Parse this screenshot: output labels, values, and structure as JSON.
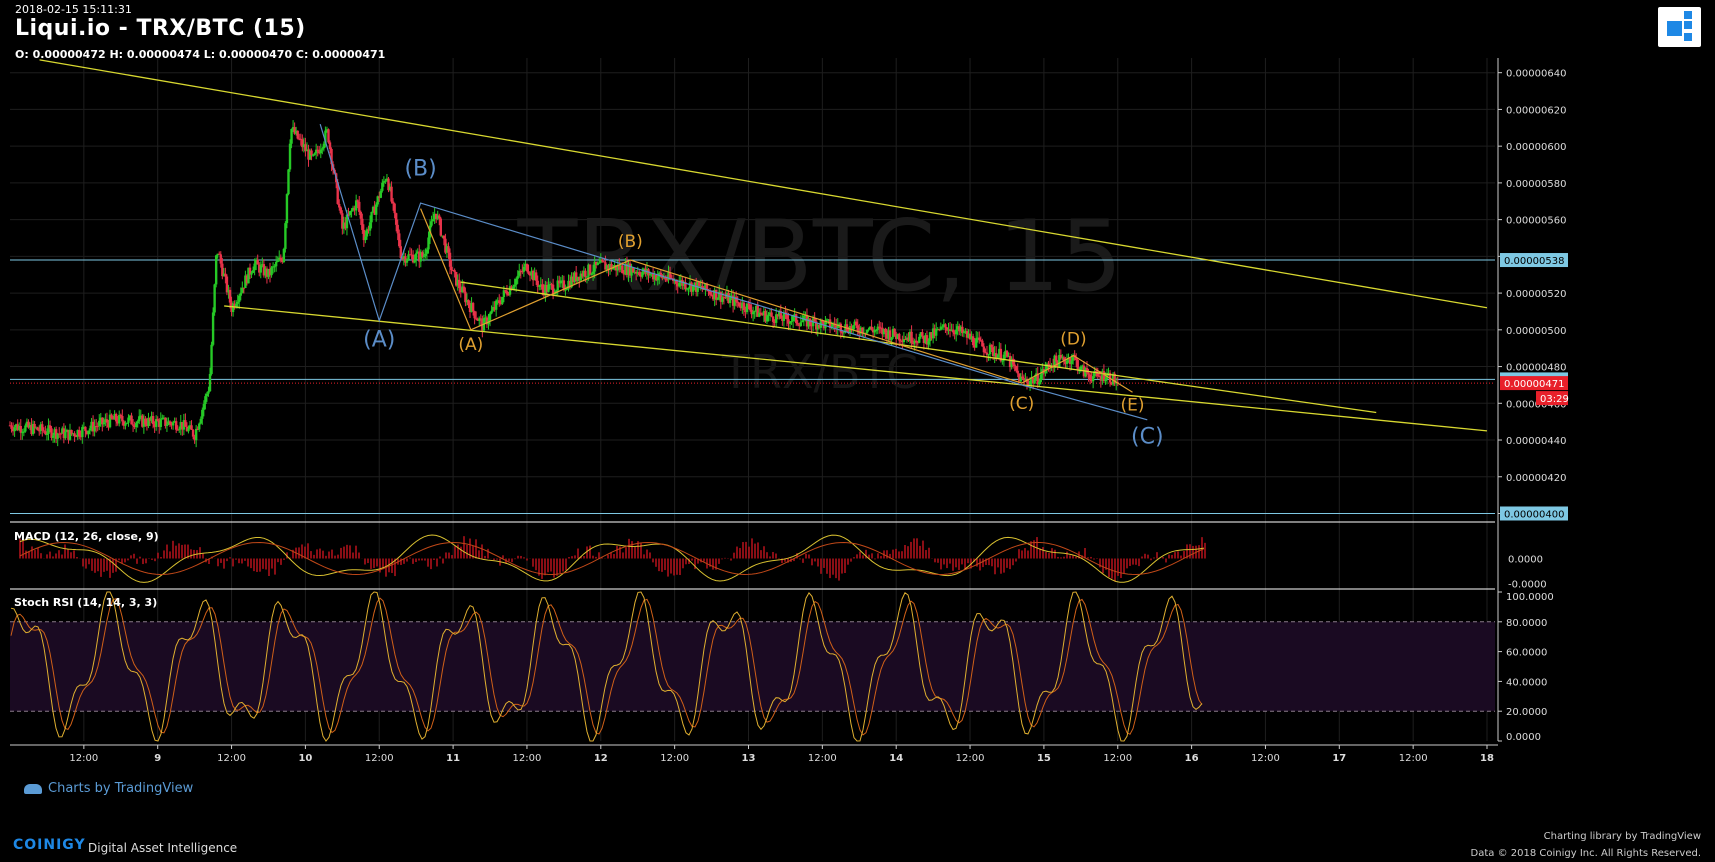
{
  "header": {
    "timestamp": "2018-02-15 15:11:31",
    "title": "Liqui.io - TRX/BTC (15)",
    "ohlc": "O: 0.00000472 H: 0.00000474 L: 0.00000470 C: 0.00000471"
  },
  "watermark": {
    "line1": "TRX/BTC, 15",
    "line2": "TRX/BTC"
  },
  "footer": {
    "brand": "COINIGY",
    "tagline": "Digital Asset Intelligence",
    "tv_link": "Charts by TradingView",
    "library_credit": "Charting library by  TradingView",
    "copyright": "Data © 2018  Coinigy Inc. All Rights Reserved."
  },
  "colors": {
    "background": "#000000",
    "up_candle": "#26c926",
    "down_candle": "#e8334a",
    "trendline": "#d8d830",
    "wave_blue": "#5b8dc8",
    "wave_orange": "#e0a030",
    "horizontal_level": "#7ec8e3",
    "price_tag": "#e8202a",
    "rsi_band": "#1a0a22"
  },
  "chart_data": [
    {
      "type": "candlestick",
      "title": "TRX/BTC, 15",
      "y_ticks": [
        "0.00000640",
        "0.00000620",
        "0.00000600",
        "0.00000580",
        "0.00000560",
        "0.00000540",
        "0.00000520",
        "0.00000500",
        "0.00000480",
        "0.00000460",
        "0.00000440",
        "0.00000420",
        "0.00000400"
      ],
      "ylim": [
        3.97e-06,
        6.48e-06
      ],
      "x_ticks": [
        "12:00",
        "9",
        "12:00",
        "10",
        "12:00",
        "11",
        "12:00",
        "12",
        "12:00",
        "13",
        "12:00",
        "14",
        "12:00",
        "15",
        "12:00",
        "16",
        "12:00",
        "17",
        "12:00",
        "18"
      ],
      "x_tick_days": [
        8.5,
        9,
        9.5,
        10,
        10.5,
        11,
        11.5,
        12,
        12.5,
        13,
        13.5,
        14,
        14.5,
        15,
        15.5,
        16,
        16.5,
        17,
        17.5,
        18
      ],
      "xlim": [
        8.0,
        18.0
      ],
      "price_path": [
        [
          8.0,
          4.48e-06
        ],
        [
          8.4,
          4.43e-06
        ],
        [
          8.7,
          4.51e-06
        ],
        [
          9.15,
          4.49e-06
        ],
        [
          9.25,
          4.43e-06
        ],
        [
          9.35,
          4.7e-06
        ],
        [
          9.4,
          5.45e-06
        ],
        [
          9.5,
          5.12e-06
        ],
        [
          9.65,
          5.36e-06
        ],
        [
          9.75,
          5.3e-06
        ],
        [
          9.85,
          5.4e-06
        ],
        [
          9.9,
          6.1e-06
        ],
        [
          10.05,
          5.92e-06
        ],
        [
          10.15,
          6.08e-06
        ],
        [
          10.25,
          5.55e-06
        ],
        [
          10.35,
          5.7e-06
        ],
        [
          10.4,
          5.5e-06
        ],
        [
          10.55,
          5.85e-06
        ],
        [
          10.65,
          5.4e-06
        ],
        [
          10.8,
          5.4e-06
        ],
        [
          10.88,
          5.65e-06
        ],
        [
          11.0,
          5.3e-06
        ],
        [
          11.1,
          5.15e-06
        ],
        [
          11.2,
          5.02e-06
        ],
        [
          11.35,
          5.2e-06
        ],
        [
          11.5,
          5.35e-06
        ],
        [
          11.6,
          5.22e-06
        ],
        [
          11.75,
          5.24e-06
        ],
        [
          11.85,
          5.3e-06
        ],
        [
          12.0,
          5.35e-06
        ],
        [
          12.2,
          5.33e-06
        ],
        [
          12.45,
          5.28e-06
        ],
        [
          12.7,
          5.22e-06
        ],
        [
          12.95,
          5.14e-06
        ],
        [
          13.1,
          5.08e-06
        ],
        [
          13.35,
          5.05e-06
        ],
        [
          13.6,
          5.02e-06
        ],
        [
          13.85,
          5e-06
        ],
        [
          14.0,
          4.97e-06
        ],
        [
          14.2,
          4.95e-06
        ],
        [
          14.35,
          5.02e-06
        ],
        [
          14.45,
          4.98e-06
        ],
        [
          14.6,
          4.9e-06
        ],
        [
          14.75,
          4.85e-06
        ],
        [
          14.85,
          4.72e-06
        ],
        [
          14.95,
          4.73e-06
        ],
        [
          15.05,
          4.82e-06
        ],
        [
          15.2,
          4.85e-06
        ],
        [
          15.25,
          4.78e-06
        ],
        [
          15.35,
          4.74e-06
        ],
        [
          15.42,
          4.76e-06
        ],
        [
          15.5,
          4.71e-06
        ]
      ],
      "last_price": "0.00000471",
      "countdown": "03:29",
      "levels": [
        {
          "value": 5.38e-06,
          "label": "0.00000538"
        },
        {
          "value": 4.73e-06,
          "label": "0.00000473"
        },
        {
          "value": 4e-06,
          "label": "0.00000400"
        }
      ],
      "trendlines": [
        {
          "from": [
            8.2,
            6.47e-06
          ],
          "to": [
            18.0,
            5.12e-06
          ]
        },
        {
          "from": [
            9.45,
            5.13e-06
          ],
          "to": [
            18.0,
            4.45e-06
          ]
        },
        {
          "from": [
            11.05,
            5.26e-06
          ],
          "to": [
            17.25,
            4.55e-06
          ]
        }
      ],
      "waves": [
        {
          "name": "blue",
          "color": "#5b8dc8",
          "points": [
            [
              10.1,
              6.12e-06
            ],
            [
              10.5,
              5.05e-06
            ],
            [
              10.78,
              5.69e-06
            ],
            [
              14.85,
              4.7e-06
            ],
            [
              15.7,
              4.51e-06
            ]
          ]
        },
        {
          "name": "orange",
          "color": "#e0a030",
          "points": [
            [
              10.78,
              5.66e-06
            ],
            [
              11.12,
              5e-06
            ],
            [
              12.2,
              5.38e-06
            ],
            [
              14.85,
              4.71e-06
            ],
            [
              15.2,
              4.86e-06
            ],
            [
              15.6,
              4.66e-06
            ]
          ]
        }
      ],
      "wave_labels": [
        {
          "text": "(B)",
          "x": 10.78,
          "y": 5.84e-06,
          "color": "#5b8dc8",
          "size": 22
        },
        {
          "text": "(A)",
          "x": 10.5,
          "y": 4.91e-06,
          "color": "#5b8dc8",
          "size": 22
        },
        {
          "text": "(C)",
          "x": 15.7,
          "y": 4.38e-06,
          "color": "#5b8dc8",
          "size": 22
        },
        {
          "text": "(B)",
          "x": 12.2,
          "y": 5.45e-06,
          "color": "#e0a030",
          "size": 17
        },
        {
          "text": "(A)",
          "x": 11.12,
          "y": 4.89e-06,
          "color": "#e0a030",
          "size": 17
        },
        {
          "text": "(D)",
          "x": 15.2,
          "y": 4.92e-06,
          "color": "#e0a030",
          "size": 17
        },
        {
          "text": "(C)",
          "x": 14.85,
          "y": 4.57e-06,
          "color": "#e0a030",
          "size": 17
        },
        {
          "text": "(E)",
          "x": 15.6,
          "y": 4.56e-06,
          "color": "#e0a030",
          "size": 17
        }
      ]
    },
    {
      "type": "bar",
      "title": "MACD (12, 26, close, 9)",
      "y_ticks": [
        "0.0000",
        "-0.0000"
      ]
    },
    {
      "type": "line",
      "title": "Stoch RSI (14, 14, 3, 3)",
      "y_ticks": [
        "100.0000",
        "80.0000",
        "60.0000",
        "40.0000",
        "20.0000",
        "0.0000"
      ],
      "ylim": [
        0,
        100
      ],
      "band": [
        20,
        80
      ]
    }
  ]
}
